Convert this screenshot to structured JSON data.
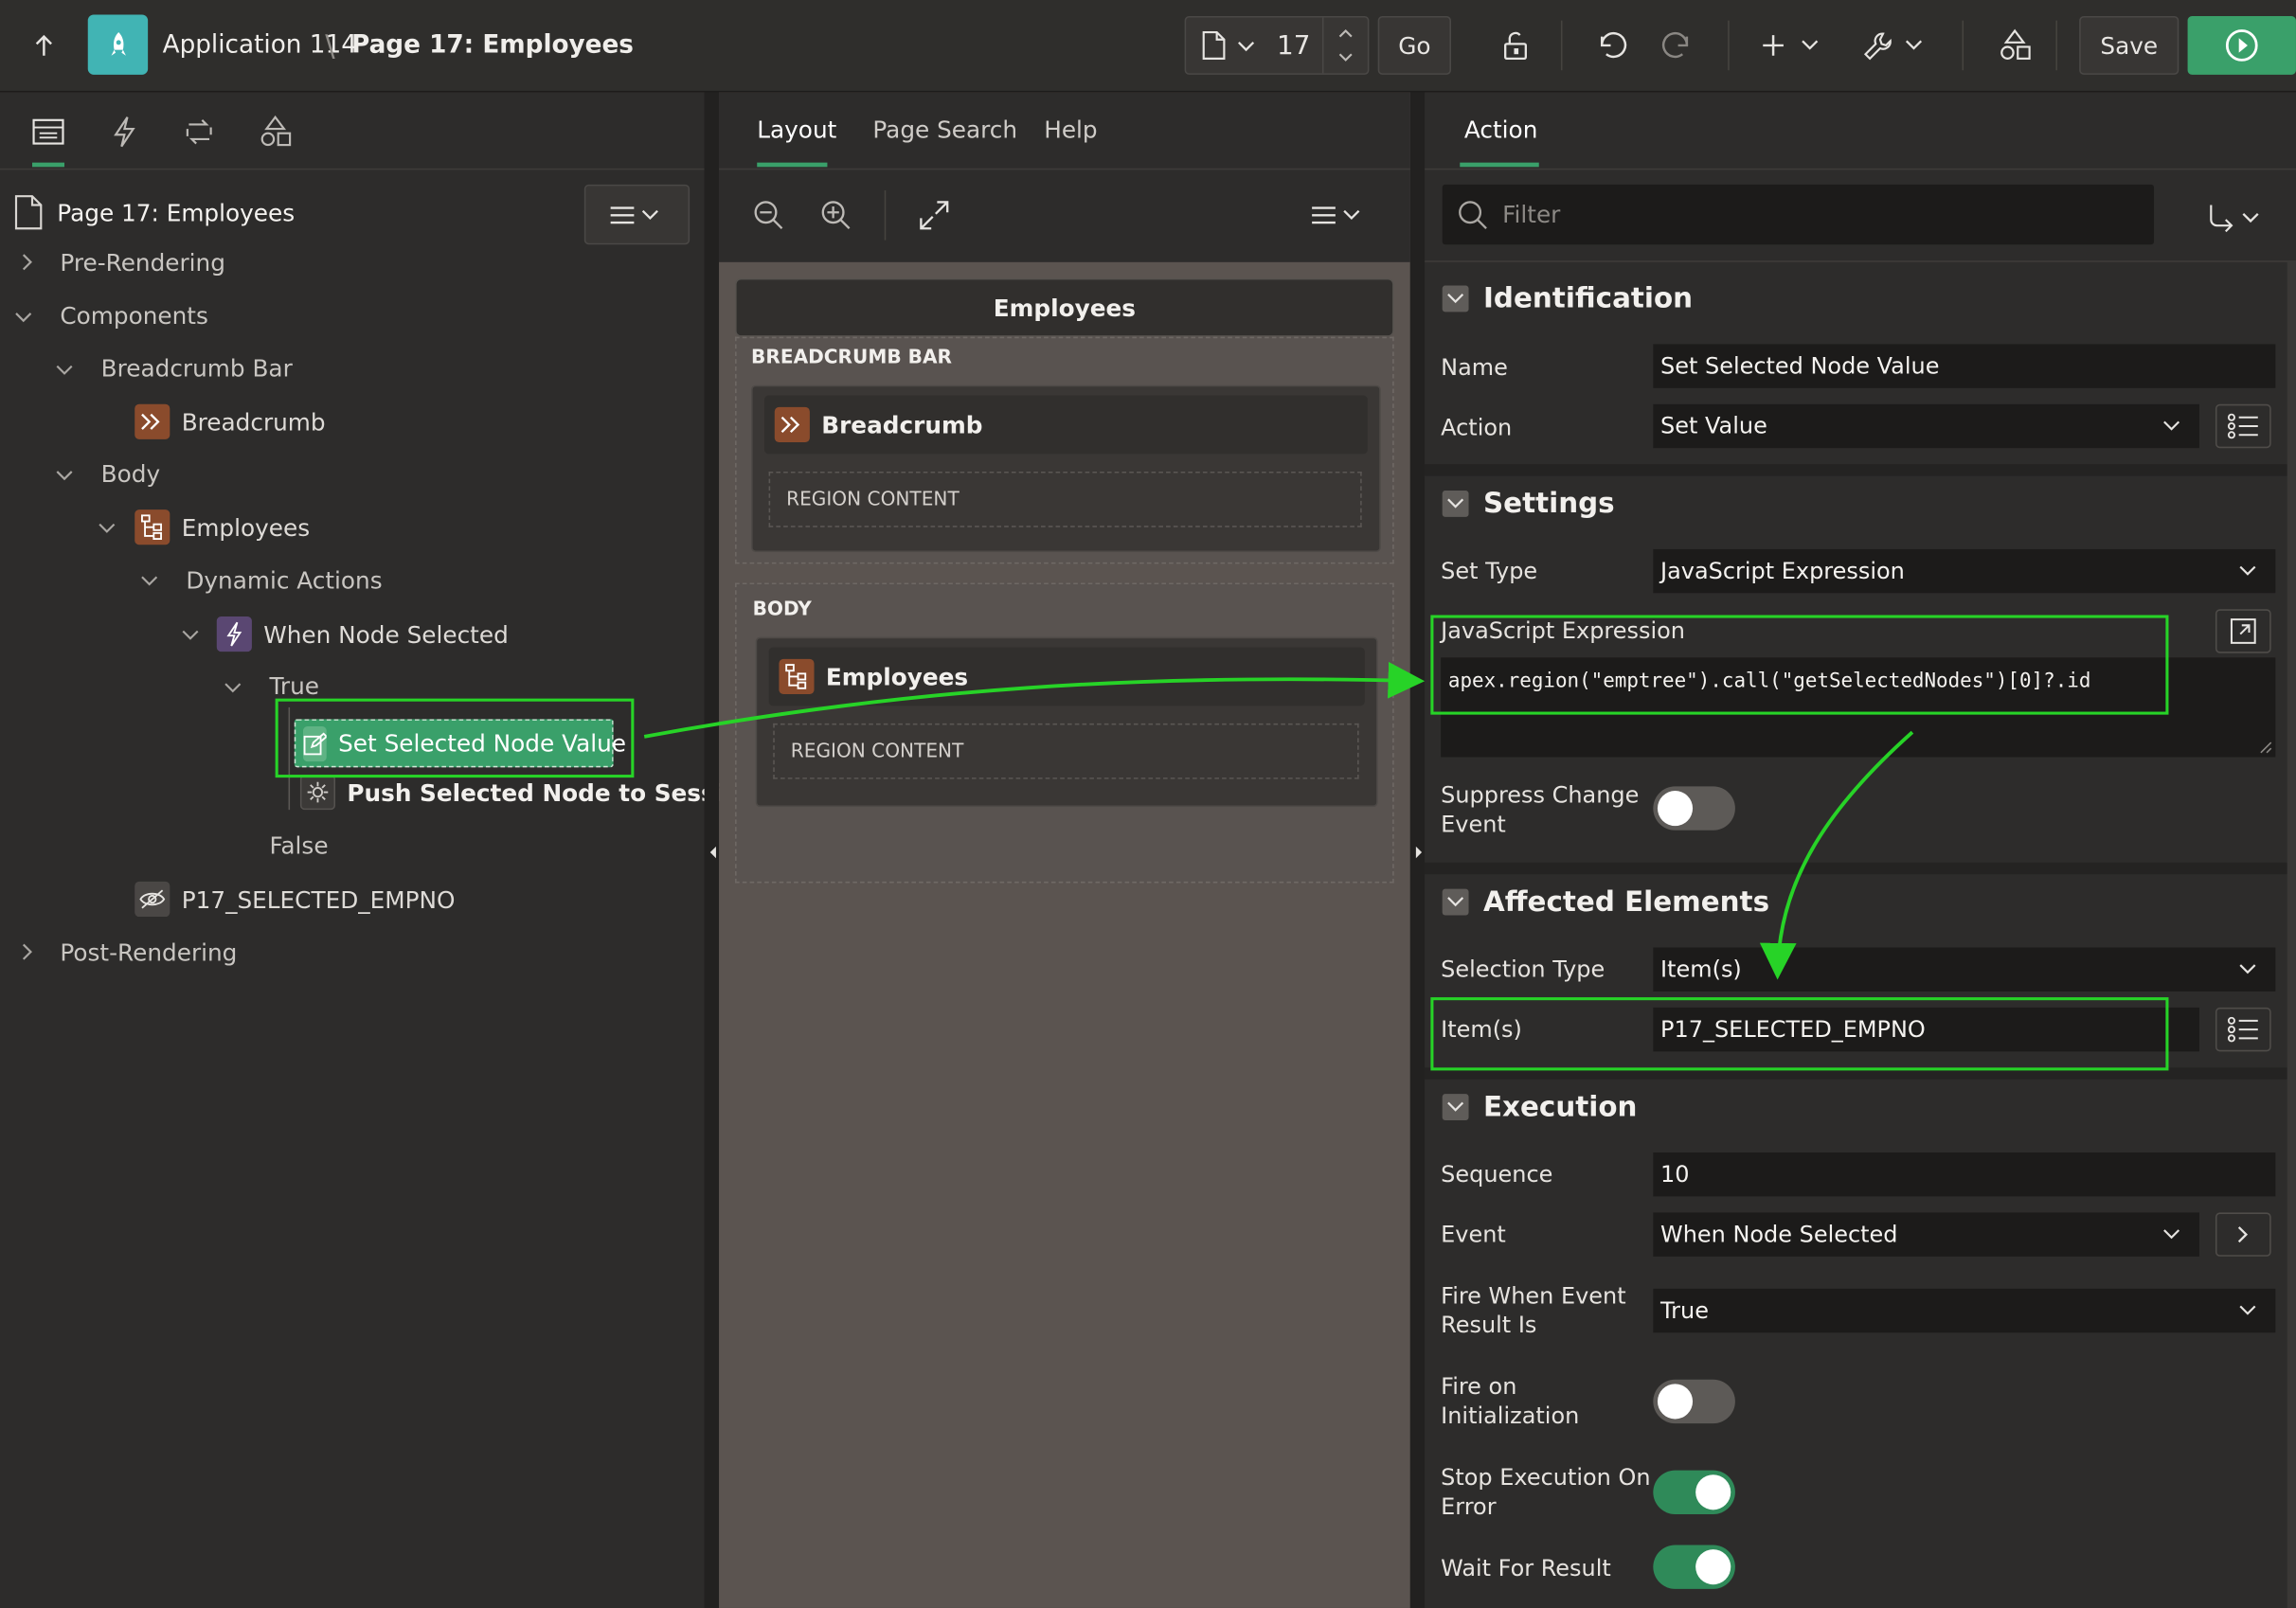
{
  "topbar": {
    "app_name": "Application 114",
    "separator": "\\",
    "page_title": "Page 17: Employees",
    "page_number": "17",
    "go_label": "Go",
    "save_label": "Save"
  },
  "left_tree": {
    "page_node": "Page 17: Employees",
    "pre_rendering": "Pre-Rendering",
    "components": "Components",
    "breadcrumb_bar": "Breadcrumb Bar",
    "breadcrumb": "Breadcrumb",
    "body": "Body",
    "employees": "Employees",
    "dynamic_actions": "Dynamic Actions",
    "when_node_selected": "When Node Selected",
    "true_branch": "True",
    "set_selected": "Set Selected Node Value",
    "push_selected": "Push Selected Node to Session",
    "false_branch": "False",
    "item": "P17_SELECTED_EMPNO",
    "post_rendering": "Post-Rendering"
  },
  "middle": {
    "tabs": [
      "Layout",
      "Page Search",
      "Help"
    ],
    "page_title": "Employees",
    "breadcrumb_bar_label": "BREADCRUMB BAR",
    "breadcrumb_region": "Breadcrumb",
    "region_content": "REGION CONTENT",
    "body_label": "BODY",
    "employees_region": "Employees"
  },
  "right": {
    "tab": "Action",
    "filter_placeholder": "Filter",
    "identification": {
      "header": "Identification",
      "name_label": "Name",
      "name_value": "Set Selected Node Value",
      "action_label": "Action",
      "action_value": "Set Value"
    },
    "settings": {
      "header": "Settings",
      "set_type_label": "Set Type",
      "set_type_value": "JavaScript Expression",
      "js_label": "JavaScript Expression",
      "js_value": "apex.region(\"emptree\").call(\"getSelectedNodes\")[0]?.id",
      "suppress_label_1": "Suppress Change",
      "suppress_label_2": "Event"
    },
    "affected": {
      "header": "Affected Elements",
      "selection_type_label": "Selection Type",
      "selection_type_value": "Item(s)",
      "items_label": "Item(s)",
      "items_value": "P17_SELECTED_EMPNO"
    },
    "execution": {
      "header": "Execution",
      "sequence_label": "Sequence",
      "sequence_value": "10",
      "event_label": "Event",
      "event_value": "When Node Selected",
      "fire_when_label_1": "Fire When Event",
      "fire_when_label_2": "Result Is",
      "fire_when_value": "True",
      "fire_init_label_1": "Fire on",
      "fire_init_label_2": "Initialization",
      "stop_label_1": "Stop Execution On",
      "stop_label_2": "Error",
      "wait_label": "Wait For Result"
    }
  },
  "colors": {
    "accent_green": "#3aa06a",
    "highlight_green": "#27d327",
    "toggle_on": "#2f8a59",
    "toggle_off": "#5d5a57"
  }
}
